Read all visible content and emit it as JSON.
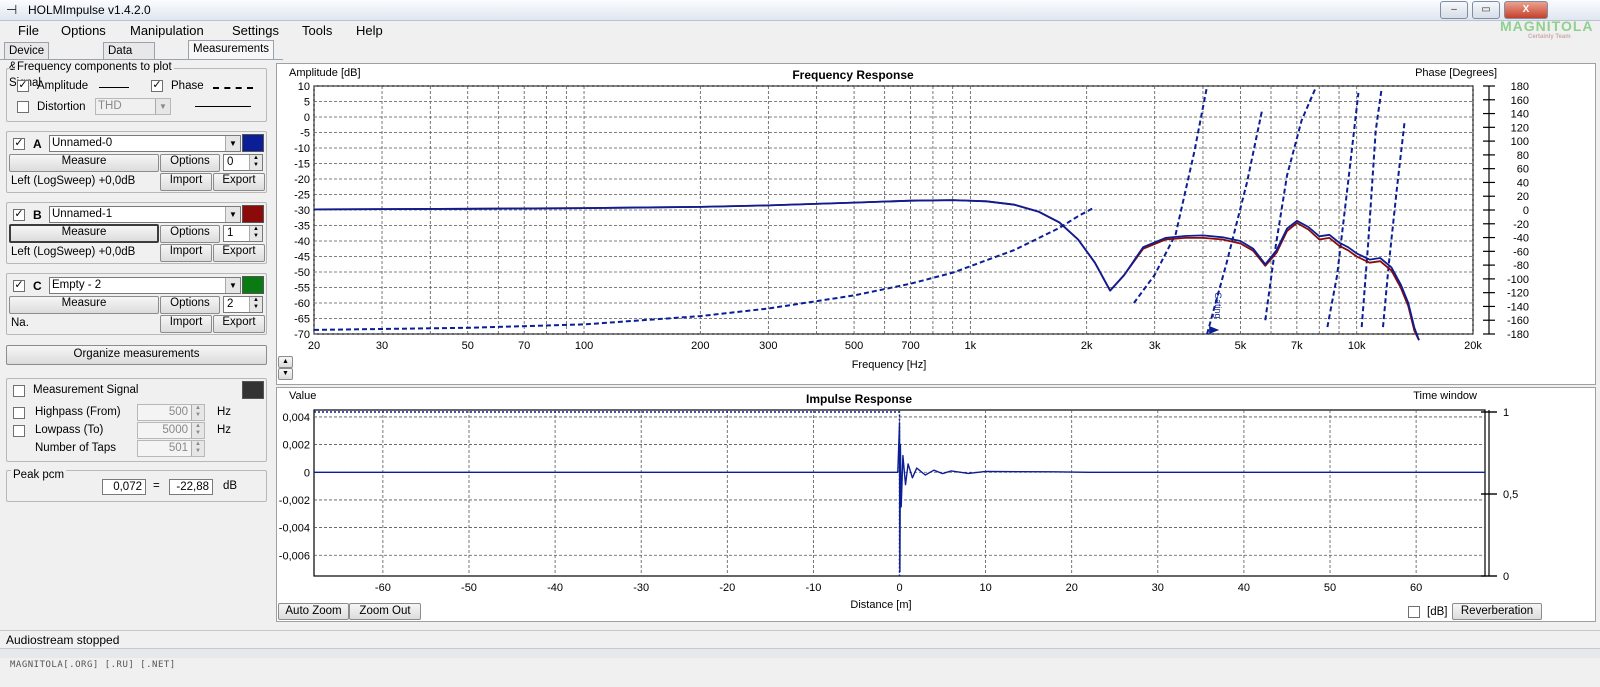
{
  "window": {
    "title": "HOLMImpulse  v1.4.2.0",
    "minimize_label": "–",
    "maximize_label": "▭",
    "close_label": "X",
    "logo_text": "MAGNITOLA",
    "logo_subtext": "Certainly Team"
  },
  "menu": [
    "File",
    "Options",
    "Manipulation",
    "Settings",
    "Tools",
    "Help"
  ],
  "tabs": [
    "Device & Signal",
    "Data analysis",
    "Measurements"
  ],
  "freq_components": {
    "legend": "Frequency components to plot",
    "amplitude_label": "Amplitude",
    "phase_label": "Phase",
    "distortion_label": "Distortion",
    "distortion_select": "THD"
  },
  "measurements": [
    {
      "letter": "A",
      "name": "Unnamed-0",
      "color": "#0b1e96",
      "measure_label": "Measure",
      "options_label": "Options",
      "index": "0",
      "source": "Left (LogSweep) +0,0dB",
      "import_label": "Import",
      "export_label": "Export"
    },
    {
      "letter": "B",
      "name": "Unnamed-1",
      "color": "#8b0a0a",
      "measure_label": "Measure",
      "options_label": "Options",
      "index": "1",
      "source": "Left (LogSweep) +0,0dB",
      "import_label": "Import",
      "export_label": "Export"
    },
    {
      "letter": "C",
      "name": "Empty - 2",
      "color": "#0a7a12",
      "measure_label": "Measure",
      "options_label": "Options",
      "index": "2",
      "source": "Na.",
      "import_label": "Import",
      "export_label": "Export"
    }
  ],
  "organize_label": "Organize measurements",
  "signal": {
    "measurement_signal_label": "Measurement Signal",
    "swatch_color": "#333333",
    "highpass_label": "Highpass (From)",
    "highpass_value": "500",
    "lowpass_label": "Lowpass (To)",
    "lowpass_value": "5000",
    "taps_label": "Number of Taps",
    "taps_value": "501",
    "hz_unit": "Hz"
  },
  "peak": {
    "legend": "Peak pcm",
    "value": "0,072",
    "equals": "=",
    "db_value": "-22,88",
    "unit": "dB"
  },
  "freq_plot": {
    "title": "Frequency Response",
    "ylabel": "Amplitude [dB]",
    "y2label": "Phase [Degrees]",
    "xlabel": "Frequency [Hz]",
    "xticks": [
      "20",
      "30",
      "50",
      "70",
      "100",
      "200",
      "300",
      "500",
      "700",
      "1k",
      "2k",
      "3k",
      "5k",
      "7k",
      "10k",
      "20k"
    ],
    "yticks": [
      "10",
      "5",
      "0",
      "-5",
      "-10",
      "-15",
      "-20",
      "-25",
      "-30",
      "-35",
      "-40",
      "-45",
      "-50",
      "-55",
      "-60",
      "-65",
      "-70"
    ],
    "y2ticks": [
      "180",
      "160",
      "140",
      "120",
      "100",
      "80",
      "60",
      "40",
      "20",
      "0",
      "-20",
      "-40",
      "-60",
      "-80",
      "-100",
      "-120",
      "-140",
      "-160",
      "-180"
    ],
    "marker_label": "Gating"
  },
  "impulse_plot": {
    "title": "Impulse Response",
    "ylabel": "Value",
    "y2label": "Time window",
    "xlabel": "Distance [m]",
    "xticks": [
      "-60",
      "-50",
      "-40",
      "-30",
      "-20",
      "-10",
      "0",
      "10",
      "20",
      "30",
      "40",
      "50",
      "60"
    ],
    "yticks": [
      "0,004",
      "0,002",
      "0",
      "-0,002",
      "-0,004",
      "-0,006"
    ],
    "y2ticks": [
      "1",
      "0,5",
      "0"
    ],
    "auto_zoom_label": "Auto Zoom",
    "zoom_out_label": "Zoom Out",
    "db_label": "[dB]",
    "reverberation_label": "Reverberation"
  },
  "chart_data": [
    {
      "type": "line",
      "title": "Frequency Response",
      "xlabel": "Frequency [Hz]",
      "ylabel": "Amplitude [dB]",
      "y2label": "Phase [Degrees]",
      "xscale": "log",
      "xlim": [
        20,
        20000
      ],
      "ylim": [
        -70,
        10
      ],
      "y2lim": [
        -180,
        180
      ],
      "grid": true,
      "series": [
        {
          "name": "A",
          "color": "#0b1e96",
          "axis": "left",
          "x": [
            20,
            50,
            100,
            200,
            300,
            500,
            700,
            900,
            1100,
            1300,
            1500,
            1700,
            1900,
            2100,
            2300,
            2500,
            2800,
            3200,
            3600,
            4000,
            4500,
            5000,
            5400,
            5800,
            6200,
            6600,
            7000,
            7500,
            8000,
            8500,
            9000,
            9500,
            10000,
            10800,
            11500,
            12300,
            13000,
            13600,
            14100,
            14500
          ],
          "y": [
            -29.8,
            -29.6,
            -29.4,
            -29,
            -28.5,
            -27.6,
            -27,
            -26.8,
            -27.2,
            -28.3,
            -30.5,
            -34,
            -39.5,
            -47,
            -56,
            -51,
            -42,
            -39,
            -38.4,
            -38.2,
            -38.8,
            -40,
            -42.5,
            -47.5,
            -43,
            -36,
            -33.5,
            -35.5,
            -38.5,
            -38,
            -40.5,
            -42,
            -44,
            -46,
            -45.5,
            -48.5,
            -54,
            -60,
            -68,
            -72
          ]
        },
        {
          "name": "B",
          "color": "#8b0a0a",
          "axis": "left",
          "x": [
            20,
            50,
            100,
            200,
            300,
            500,
            700,
            900,
            1100,
            1300,
            1500,
            1700,
            1900,
            2100,
            2300,
            2500,
            2800,
            3200,
            3600,
            4000,
            4500,
            5000,
            5400,
            5800,
            6200,
            6600,
            7000,
            7500,
            8000,
            8500,
            9000,
            9500,
            10000,
            10800,
            11500,
            12300,
            13000,
            13600,
            14100,
            14500
          ],
          "y": [
            -29.8,
            -29.6,
            -29.4,
            -29,
            -28.5,
            -27.6,
            -27,
            -26.8,
            -27.2,
            -28.3,
            -30.5,
            -34,
            -39.5,
            -47,
            -56,
            -51,
            -42.5,
            -39.5,
            -39,
            -39,
            -39.5,
            -40.8,
            -43.2,
            -48,
            -43.8,
            -36.8,
            -34.2,
            -36.3,
            -39.5,
            -39,
            -41.5,
            -43,
            -45,
            -47,
            -46.5,
            -49.5,
            -55,
            -61,
            -69,
            -72
          ]
        },
        {
          "name": "Phase A",
          "color": "#0b1e96",
          "axis": "right",
          "dashed": true,
          "x": [
            20,
            50,
            100,
            200,
            300,
            500,
            700,
            900,
            1100,
            1300,
            1500,
            1700,
            1900,
            2100
          ],
          "y": [
            -174,
            -171,
            -166,
            -154,
            -143,
            -124,
            -107,
            -91,
            -73,
            -58,
            -41,
            -26,
            -9,
            4
          ]
        },
        {
          "name": "Phase A (HF)",
          "color": "#0b1e96",
          "axis": "right",
          "dashed": true,
          "x": [
            2650,
            3000,
            3400,
            3800,
            4100
          ],
          "y": [
            -135,
            -94,
            -35,
            85,
            180
          ]
        },
        {
          "name": "Phase A (HF 2)",
          "color": "#0b1e96",
          "axis": "right",
          "dashed": true,
          "x": [
            4100,
            4600,
            5200,
            5700
          ],
          "y": [
            -180,
            -78,
            40,
            147
          ]
        },
        {
          "name": "Phase A (HF 3)",
          "color": "#0b1e96",
          "axis": "right",
          "dashed": true,
          "x": [
            5800,
            6100,
            6600,
            7200,
            7800
          ],
          "y": [
            -160,
            -70,
            50,
            130,
            175
          ]
        },
        {
          "name": "Phase A (HF 4)",
          "color": "#0b1e96",
          "axis": "right",
          "dashed": true,
          "x": [
            8400,
            8900,
            9500,
            10100
          ],
          "y": [
            -170,
            -95,
            40,
            170
          ]
        },
        {
          "name": "Phase A (HF 5)",
          "color": "#0b1e96",
          "axis": "right",
          "dashed": true,
          "x": [
            10300,
            10700,
            11200,
            11600
          ],
          "y": [
            -170,
            -50,
            115,
            176
          ]
        },
        {
          "name": "Phase A (HF 6)",
          "color": "#0b1e96",
          "axis": "right",
          "dashed": true,
          "x": [
            11700,
            12100,
            12700,
            13300
          ],
          "y": [
            -170,
            -80,
            30,
            128
          ]
        }
      ]
    },
    {
      "type": "line",
      "title": "Impulse Response",
      "xlabel": "Distance [m]",
      "ylabel": "Value",
      "y2label": "Time window",
      "xlim": [
        -68,
        68
      ],
      "ylim": [
        -0.0075,
        0.0045
      ],
      "y2lim": [
        0,
        1
      ],
      "grid": true,
      "series": [
        {
          "name": "Impulse",
          "color": "#0b1e96",
          "x": [
            -68,
            -0.2,
            0,
            0.05,
            0.1,
            0.2,
            0.4,
            0.7,
            1.0,
            1.5,
            2.0,
            3,
            4,
            5,
            6,
            8,
            10,
            14,
            18,
            22,
            68
          ],
          "y": [
            0,
            0,
            0.0035,
            -0.0072,
            0.002,
            -0.0025,
            0.0012,
            -0.0009,
            0.0006,
            -0.0004,
            0.0003,
            -0.0002,
            0.00015,
            -0.0001,
            0.0001,
            -8e-05,
            6e-05,
            4e-05,
            3e-05,
            0,
            0
          ]
        },
        {
          "name": "Time window",
          "color": "#0b1e96",
          "dashed": true,
          "axis": "right",
          "x": [
            -68,
            0,
            0
          ],
          "y": [
            1,
            1,
            0
          ]
        }
      ]
    }
  ]
}
